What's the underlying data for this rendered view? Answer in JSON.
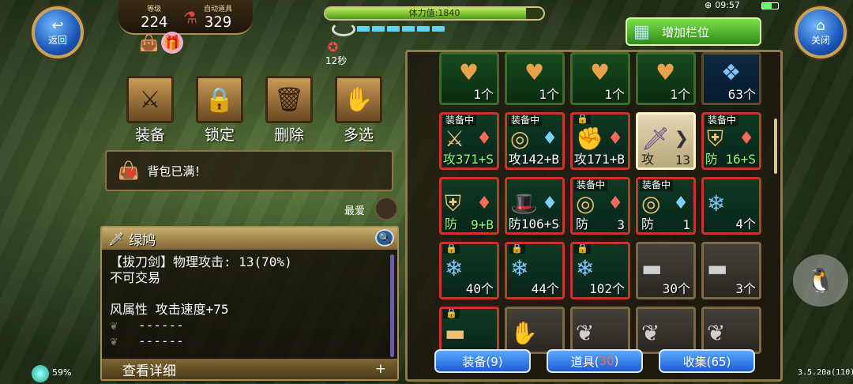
{
  "top": {
    "back_label": "返回",
    "close_label": "关闭",
    "level_label": "等级",
    "level_value": "224",
    "auto_items_label": "自动道具",
    "auto_items_value": "329",
    "stamina_text": "体力值:1840",
    "stamina_fraction": 0.92,
    "timer": "12秒",
    "clock": "09:57",
    "add_slots_label": "增加栏位"
  },
  "actions": [
    {
      "label": "装备",
      "icon": "equipment-icon"
    },
    {
      "label": "锁定",
      "icon": "lock-icon"
    },
    {
      "label": "删除",
      "icon": "trash-icon"
    },
    {
      "label": "多选",
      "icon": "hand-icon"
    }
  ],
  "message": "背包已满！",
  "favorite_label": "最爱",
  "detail": {
    "name": "绿鸠",
    "line1": "【拔刀剑】物理攻击: 13(70%)",
    "line2": "不可交易",
    "line3": "",
    "line4": "风属性 攻击速度+75",
    "line5": "------",
    "line6": "------",
    "footer": "查看详细",
    "footer_plus": "+"
  },
  "inventory": {
    "rows": [
      [
        {
          "style": "green",
          "tag": "",
          "c1": "♥",
          "c2": "",
          "count": "1个",
          "icon": "heart-token-icon"
        },
        {
          "style": "green",
          "tag": "",
          "c1": "♥",
          "c2": "",
          "count": "1个",
          "icon": "heart-token-icon"
        },
        {
          "style": "green",
          "tag": "",
          "c1": "♥",
          "c2": "",
          "count": "1个",
          "icon": "heart-token-icon"
        },
        {
          "style": "green",
          "tag": "",
          "c1": "♥",
          "c2": "",
          "count": "1个",
          "icon": "heart-token-icon"
        },
        {
          "style": "blue",
          "tag": "",
          "c1": "❖",
          "c2": "",
          "count": "63个",
          "icon": "blue-crystal-icon"
        }
      ],
      [
        {
          "style": "red",
          "tag": "装备中",
          "c1": "⚔",
          "c2": "♦",
          "count": "攻371+S",
          "icon": "sword-icon",
          "green": true
        },
        {
          "style": "red",
          "tag": "装备中",
          "c1": "◎",
          "c2": "♦",
          "count": "攻142+B",
          "icon": "ring-icon"
        },
        {
          "style": "red",
          "tag": "",
          "c1": "✊",
          "c2": "♦",
          "count": "攻171+B",
          "icon": "gauntlet-icon"
        },
        {
          "style": "sel",
          "tag": "",
          "c1": "🗡",
          "c2": "❯",
          "count": "13",
          "pre": "攻",
          "icon": "katana-icon"
        },
        {
          "style": "red",
          "tag": "装备中",
          "c1": "⛨",
          "c2": "♦",
          "count": "防 16+S",
          "icon": "armor-icon",
          "green": true
        }
      ],
      [
        {
          "style": "red",
          "tag": "",
          "c1": "⛨",
          "c2": "♦",
          "count": "9+B",
          "pre": "防",
          "icon": "armor-icon",
          "green": true
        },
        {
          "style": "red",
          "tag": "",
          "c1": "🎩",
          "c2": "♦",
          "count": "防106+S",
          "icon": "hat-icon"
        },
        {
          "style": "red",
          "tag": "装备中",
          "c1": "◎",
          "c2": "♦",
          "count": "3",
          "pre": "防",
          "icon": "ring-icon"
        },
        {
          "style": "red",
          "tag": "装备中",
          "c1": "◎",
          "c2": "♦",
          "count": "1",
          "pre": "防",
          "icon": "ring-icon"
        },
        {
          "style": "red",
          "tag": "",
          "c1": "❄",
          "c2": "",
          "count": "4个",
          "icon": "blue-shards-icon"
        }
      ],
      [
        {
          "style": "red",
          "tag": "",
          "c1": "❄",
          "c2": "",
          "count": "40个",
          "icon": "blue-shards-icon"
        },
        {
          "style": "red",
          "tag": "",
          "c1": "❄",
          "c2": "",
          "count": "44个",
          "icon": "blue-shards-icon"
        },
        {
          "style": "red",
          "tag": "",
          "c1": "❄",
          "c2": "",
          "count": "102个",
          "icon": "blue-shards-icon"
        },
        {
          "style": "grey",
          "tag": "",
          "c1": "▬",
          "c2": "",
          "count": "30个",
          "icon": "iron-ingot-icon"
        },
        {
          "style": "grey",
          "tag": "",
          "c1": "▬",
          "c2": "",
          "count": "3个",
          "icon": "iron-ingot-icon"
        }
      ],
      [
        {
          "style": "red",
          "tag": "",
          "c1": "▬",
          "c2": "",
          "count": "",
          "icon": "iron-ingot-icon"
        },
        {
          "style": "grey",
          "tag": "",
          "c1": "✋",
          "c2": "",
          "count": "",
          "icon": "glove-icon"
        },
        {
          "style": "grey",
          "tag": "",
          "c1": "❦",
          "c2": "",
          "count": "",
          "icon": "fang-icon"
        },
        {
          "style": "grey",
          "tag": "",
          "c1": "❦",
          "c2": "",
          "count": "",
          "icon": "fang-icon"
        },
        {
          "style": "grey",
          "tag": "",
          "c1": "❦",
          "c2": "",
          "count": "",
          "icon": "fang-icon"
        }
      ]
    ]
  },
  "tabs": [
    {
      "label": "装备(9)",
      "name": "tab-equipment"
    },
    {
      "pre": "道具(",
      "num": "30",
      "post": ")",
      "name": "tab-items"
    },
    {
      "label": "收集(65)",
      "name": "tab-collection"
    }
  ],
  "status": {
    "battery": "59%",
    "version": "3.5.20a(110)"
  }
}
